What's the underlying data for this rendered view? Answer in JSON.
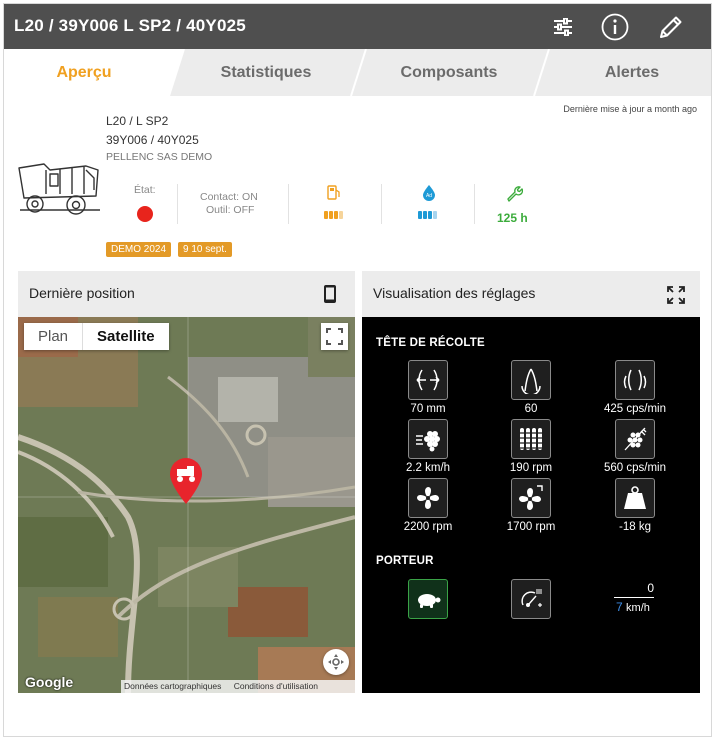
{
  "header": {
    "title": "L20 / 39Y006 L SP2 / 40Y025",
    "icons": [
      "sliders-icon",
      "info-icon",
      "pencil-icon"
    ]
  },
  "tabs": [
    {
      "label": "Aperçu",
      "active": true
    },
    {
      "label": "Statistiques",
      "active": false
    },
    {
      "label": "Composants",
      "active": false
    },
    {
      "label": "Alertes",
      "active": false
    }
  ],
  "summary": {
    "updated": "Dernière mise à jour a month ago",
    "line1": "L20 / L SP2",
    "line2": "39Y006 / 40Y025",
    "line3": "PELLENC SAS DEMO",
    "state_label": "État:",
    "state_color": "#e8241c",
    "contact": "Contact: ON",
    "tool": "Outil: OFF",
    "fuel_level": 0.75,
    "adblue_level": 0.75,
    "hours": "125 h",
    "badges": [
      "DEMO 2024",
      "9 10 sept."
    ]
  },
  "colors": {
    "accent": "#f0a020",
    "ok": "#3cac3c",
    "badge": "#e39a27"
  },
  "position_panel": {
    "title": "Dernière position",
    "map_types": [
      "Plan",
      "Satellite"
    ],
    "selected_map_type": "Satellite",
    "footer": [
      "Google",
      "Données cartographiques",
      "Conditions d'utilisation"
    ]
  },
  "settings_panel": {
    "title": "Visualisation des réglages",
    "head_section": "TÊTE DE RÉCOLTE",
    "head_items": [
      {
        "icon": "shaker-spacing-icon",
        "value": "70 mm"
      },
      {
        "icon": "shaker-amplitude-icon",
        "value": "60"
      },
      {
        "icon": "shaker-frequency-icon",
        "value": "425 cps/min"
      },
      {
        "icon": "conveyor-speed-icon",
        "value": "2.2 km/h"
      },
      {
        "icon": "destemmer-icon",
        "value": "190 rpm"
      },
      {
        "icon": "sorter-icon",
        "value": "560 cps/min"
      },
      {
        "icon": "fan-icon",
        "value": "2200 rpm"
      },
      {
        "icon": "fan-small-icon",
        "value": "1700 rpm"
      },
      {
        "icon": "weight-icon",
        "value": "-18 kg"
      }
    ],
    "carrier_section": "PORTEUR",
    "carrier_speed_top": "0",
    "carrier_speed_bottom": "7",
    "carrier_speed_unit": "km/h"
  }
}
